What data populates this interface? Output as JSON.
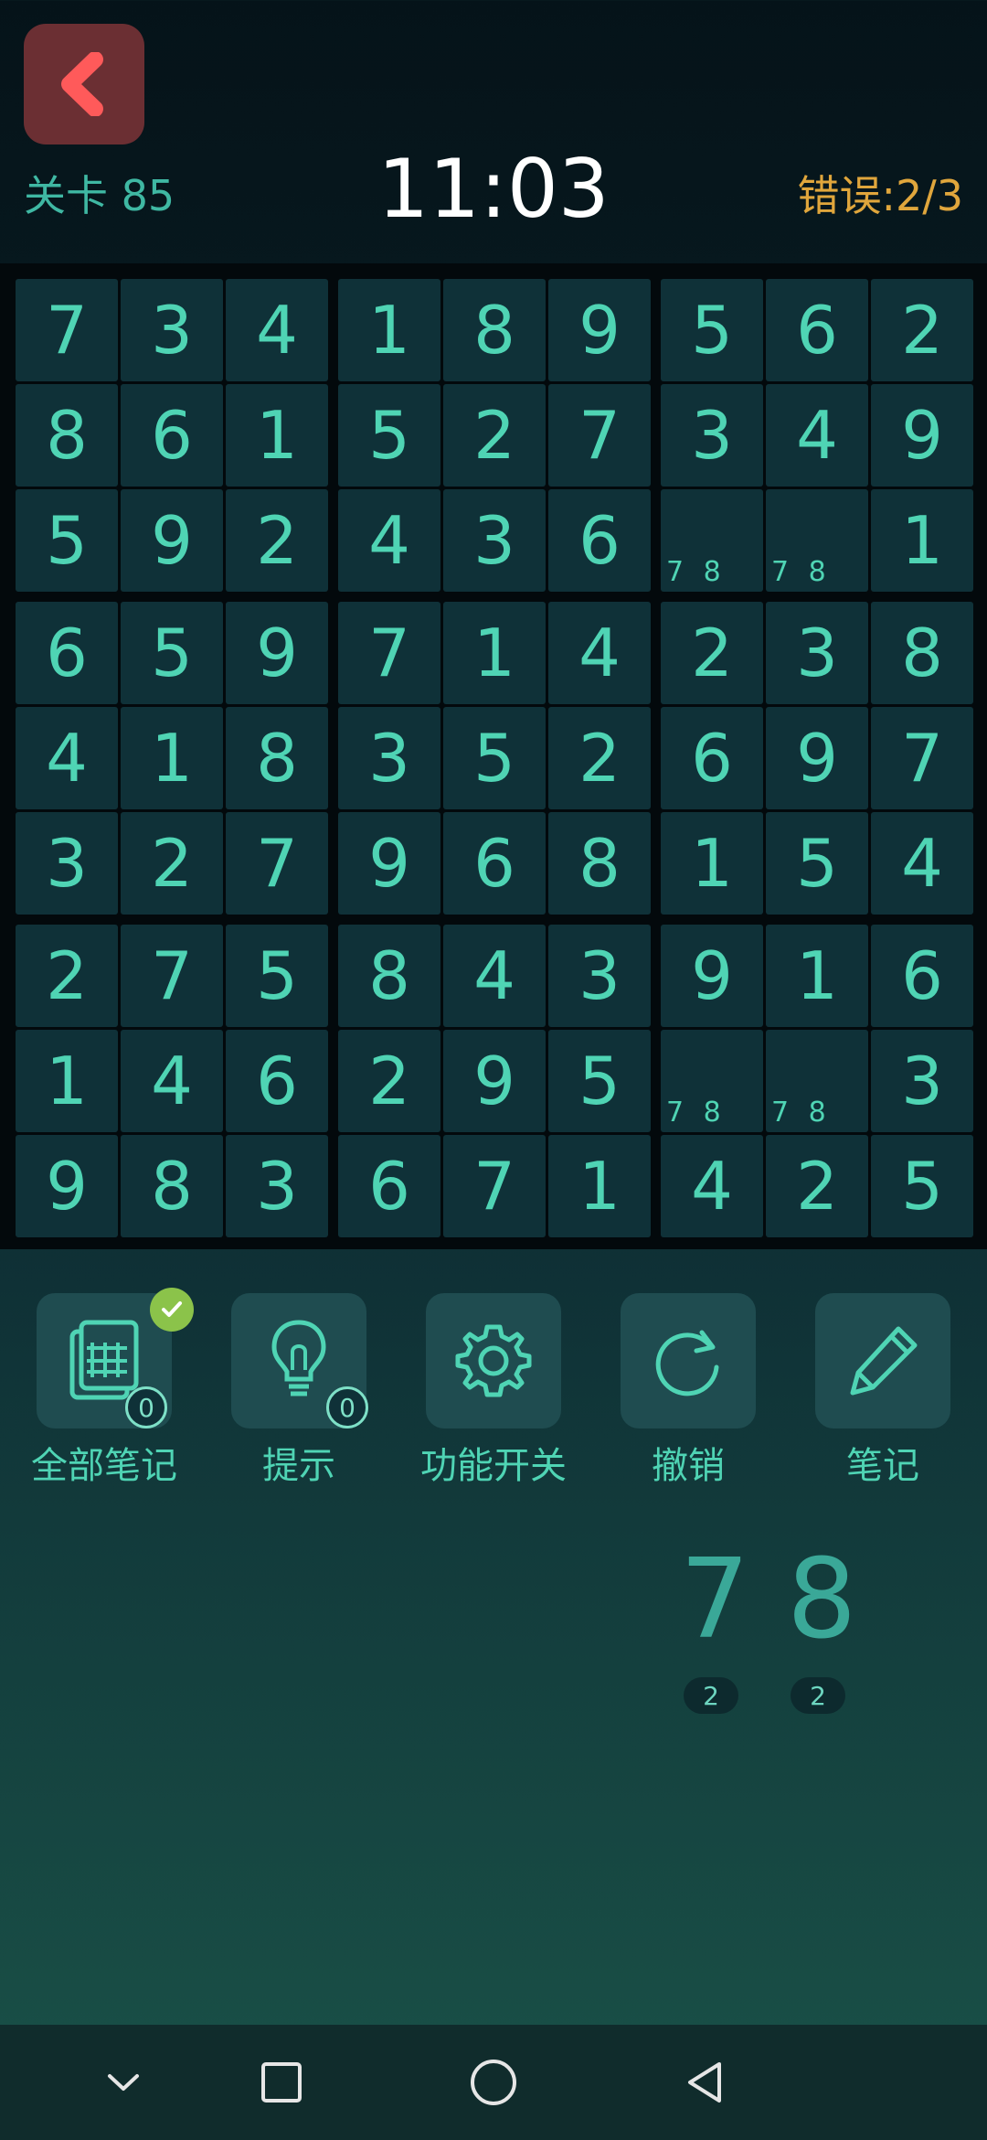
{
  "header": {
    "level": "关卡 85",
    "timer": "11:03",
    "errors": "错误:2/3"
  },
  "board": {
    "rows": [
      [
        "7",
        "3",
        "4",
        "1",
        "8",
        "9",
        "5",
        "6",
        "2"
      ],
      [
        "8",
        "6",
        "1",
        "5",
        "2",
        "7",
        "3",
        "4",
        "9"
      ],
      [
        "5",
        "9",
        "2",
        "4",
        "3",
        "6",
        "",
        "",
        "1"
      ],
      [
        "6",
        "5",
        "9",
        "7",
        "1",
        "4",
        "2",
        "3",
        "8"
      ],
      [
        "4",
        "1",
        "8",
        "3",
        "5",
        "2",
        "6",
        "9",
        "7"
      ],
      [
        "3",
        "2",
        "7",
        "9",
        "6",
        "8",
        "1",
        "5",
        "4"
      ],
      [
        "2",
        "7",
        "5",
        "8",
        "4",
        "3",
        "9",
        "1",
        "6"
      ],
      [
        "1",
        "4",
        "6",
        "2",
        "9",
        "5",
        "",
        "",
        "3"
      ],
      [
        "9",
        "8",
        "3",
        "6",
        "7",
        "1",
        "4",
        "2",
        "5"
      ]
    ],
    "notes": {
      "2-6": "7 8",
      "2-7": "7 8",
      "7-6": "7 8",
      "7-7": "7 8"
    }
  },
  "toolbar": {
    "items": [
      {
        "label": "全部笔记",
        "icon": "notes-grid-icon",
        "badge": "0",
        "checked": true
      },
      {
        "label": "提示",
        "icon": "lightbulb-icon",
        "badge": "0"
      },
      {
        "label": "功能开关",
        "icon": "gear-icon"
      },
      {
        "label": "撤销",
        "icon": "undo-icon"
      },
      {
        "label": "笔记",
        "icon": "pencil-icon"
      }
    ]
  },
  "numpad": {
    "digits": [
      {
        "digit": "7",
        "count": "2"
      },
      {
        "digit": "8",
        "count": "2"
      }
    ]
  },
  "colors": {
    "accent": "#4fd4b4",
    "error": "#e0a63c",
    "back": "#6b2f33",
    "back_arrow": "#ff5a5a",
    "check": "#8bc34a"
  }
}
